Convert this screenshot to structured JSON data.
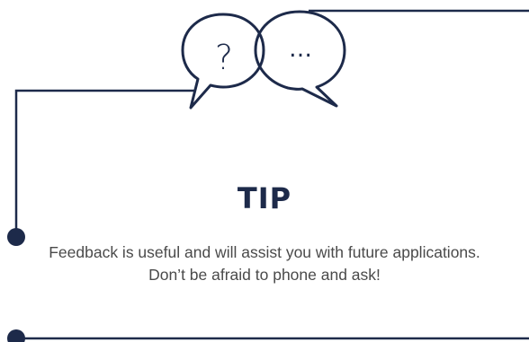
{
  "tip": {
    "heading": "TIP",
    "body": "Feedback is useful and will assist you with future applications. Don’t be afraid to phone and ask!"
  },
  "icons": {
    "left_bubble": "question-mark-speech-bubble-icon",
    "right_bubble": "ellipsis-speech-bubble-icon"
  },
  "bubble_glyphs": {
    "question": "?",
    "ellipsis": "…"
  },
  "colors": {
    "accent": "#1d2a4a",
    "body_text": "#4a4a4a",
    "background": "#ffffff"
  }
}
